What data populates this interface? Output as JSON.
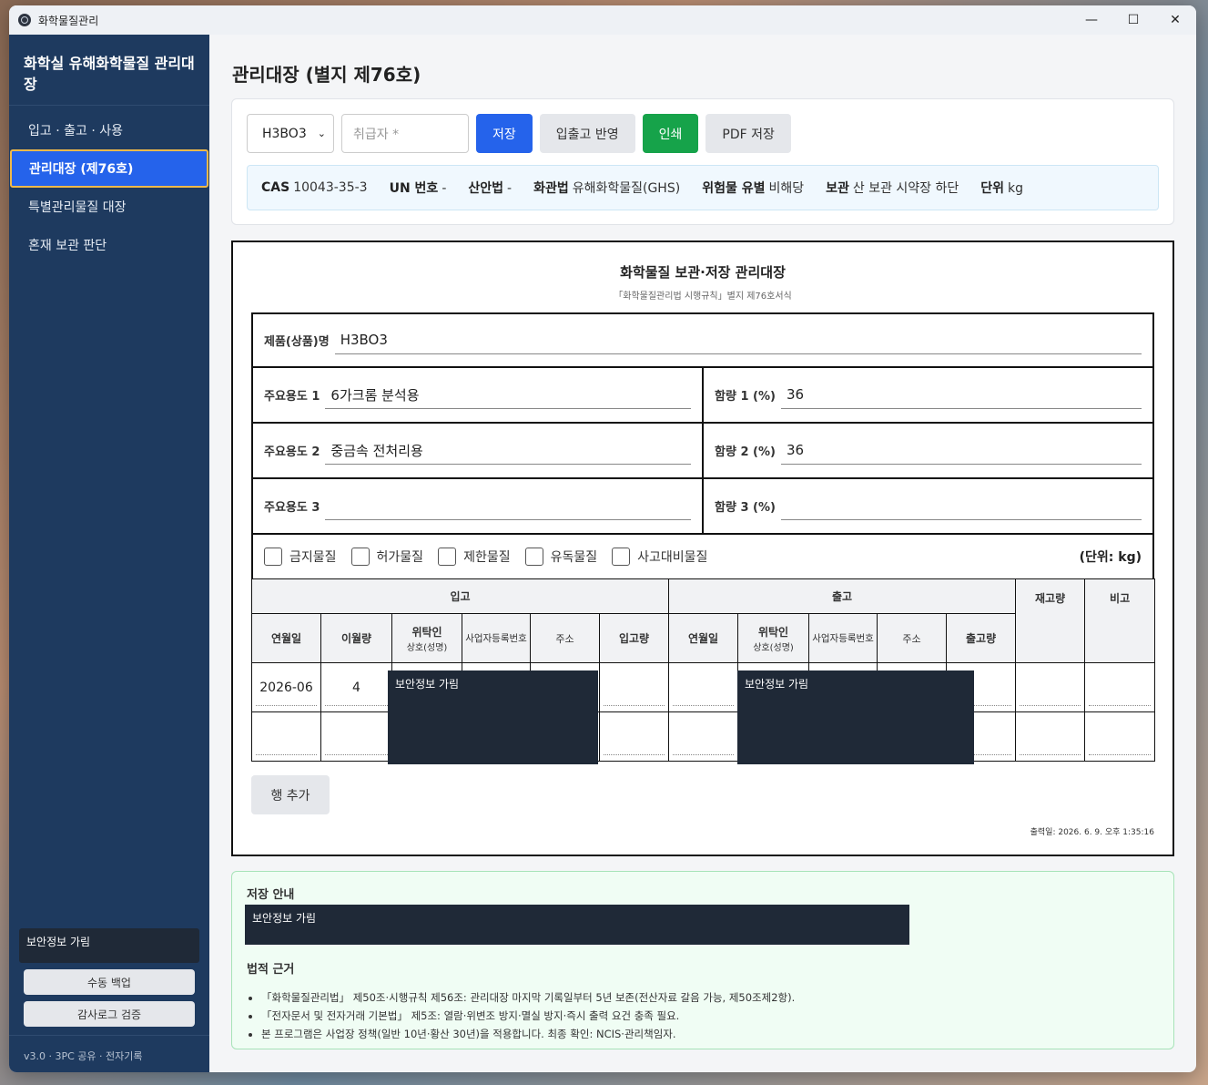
{
  "window": {
    "title": "화학물질관리",
    "minimize": "—",
    "maximize": "☐",
    "close": "✕"
  },
  "sidebar": {
    "title": "화학실 유해화학물질 관리대장",
    "items": [
      {
        "label": "입고 · 출고 · 사용"
      },
      {
        "label": "관리대장 (제76호)"
      },
      {
        "label": "특별관리물질 대장"
      },
      {
        "label": "혼재 보관 판단"
      }
    ],
    "secure_text": "보안정보 가림",
    "backup_button": "수동 백업",
    "audit_button": "감사로그 검증",
    "footer": "v3.0 · 3PC 공유 · 전자기록"
  },
  "page": {
    "title": "관리대장 (별지 제76호)"
  },
  "toolbar": {
    "chemical_select": "H3BO3",
    "handler_placeholder": "취급자 *",
    "save": "저장",
    "apply": "입출고 반영",
    "print": "인쇄",
    "pdf": "PDF 저장"
  },
  "info": {
    "cas_label": "CAS",
    "cas": "10043-35-3",
    "un_label": "UN 번호",
    "un": "-",
    "osh_label": "산안법",
    "osh": "-",
    "chem_label": "화관법",
    "chem": "유해화학물질(GHS)",
    "danger_label": "위험물 유별",
    "danger": "비해당",
    "storage_label": "보관",
    "storage": "산 보관 시약장 하단",
    "unit_label": "단위",
    "unit": "kg"
  },
  "document": {
    "title": "화학물질 보관·저장 관리대장",
    "subtitle": "「화학물질관리법 시행규칙」별지 제76호서식",
    "product_label": "제품(상품)명",
    "product": "H3BO3",
    "use1_label": "주요용도 1",
    "use1": "6가크롬 분석용",
    "use2_label": "주요용도 2",
    "use2": "중금속 전처리용",
    "use3_label": "주요용도 3",
    "use3": "",
    "content1_label": "함량 1 (%)",
    "content1": "36",
    "content2_label": "함량 2 (%)",
    "content2": "36",
    "content3_label": "함량 3 (%)",
    "content3": "",
    "checks": [
      "금지물질",
      "허가물질",
      "제한물질",
      "유독물질",
      "사고대비물질"
    ],
    "unit_note": "(단위: kg)",
    "table": {
      "in_group": "입고",
      "out_group": "출고",
      "stock": "재고량",
      "remarks": "비고",
      "date": "연월일",
      "carryover": "이월량",
      "consignor": "위탁인",
      "consignor_sub": "상호(성명)",
      "bizno": "사업자등록번호",
      "address": "주소",
      "in_qty": "입고량",
      "out_qty": "출고량",
      "rows": [
        {
          "date": "2026-06",
          "carryover": "4"
        },
        {
          "date": "",
          "carryover": ""
        }
      ],
      "mask_text": "보안정보 가림"
    },
    "add_row": "행 추가",
    "printed": "출력일: 2026. 6. 9. 오후 1:35:16"
  },
  "notice": {
    "storage_title": "저장 안내",
    "storage_mask": "보안정보 가림",
    "legal_title": "법적 근거",
    "items": [
      "「화학물질관리법」 제50조·시행규칙 제56조: 관리대장 마지막 기록일부터 5년 보존(전산자료 갈음 가능, 제50조제2항).",
      "「전자문서 및 전자거래 기본법」 제5조: 열람·위변조 방지·멸실 방지·즉시 출력 요건 충족 필요.",
      "본 프로그램은 사업장 정책(일반 10년·황산 30년)을 적용합니다. 최종 확인: NCIS·관리책임자."
    ]
  }
}
